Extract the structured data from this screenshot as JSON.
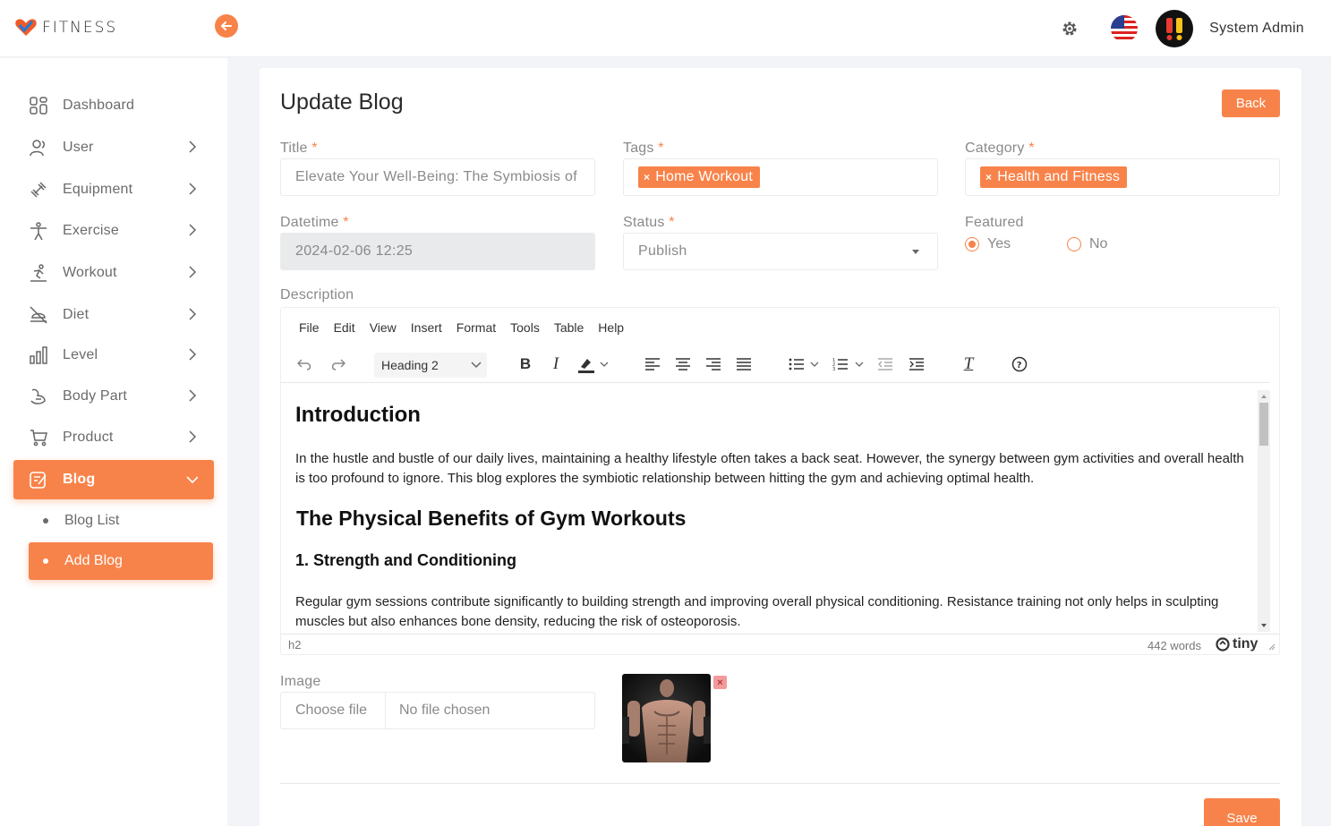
{
  "brand": {
    "logo_text": "FITNESS",
    "accent": "#f8834a"
  },
  "header": {
    "user_name": "System Admin"
  },
  "sidebar": {
    "items": [
      {
        "label": "Dashboard",
        "icon": "dashboard-icon"
      },
      {
        "label": "User",
        "icon": "user-icon"
      },
      {
        "label": "Equipment",
        "icon": "equipment-icon"
      },
      {
        "label": "Exercise",
        "icon": "exercise-icon"
      },
      {
        "label": "Workout",
        "icon": "workout-icon"
      },
      {
        "label": "Diet",
        "icon": "diet-icon"
      },
      {
        "label": "Level",
        "icon": "level-icon"
      },
      {
        "label": "Body Part",
        "icon": "body-part-icon"
      },
      {
        "label": "Product",
        "icon": "cart-icon"
      },
      {
        "label": "Blog",
        "icon": "blog-icon"
      }
    ],
    "blog_sub": [
      {
        "label": "Blog List"
      },
      {
        "label": "Add Blog"
      }
    ]
  },
  "page": {
    "title": "Update Blog",
    "back_label": "Back",
    "save_label": "Save"
  },
  "form": {
    "title_label": "Title",
    "title_value": "Elevate Your Well-Being: The Symbiosis of",
    "tags_label": "Tags",
    "tags": [
      "Home Workout"
    ],
    "category_label": "Category",
    "categories": [
      "Health and Fitness"
    ],
    "datetime_label": "Datetime",
    "datetime_value": "2024-02-06 12:25",
    "status_label": "Status",
    "status_value": "Publish",
    "featured_label": "Featured",
    "featured_yes": "Yes",
    "featured_no": "No",
    "description_label": "Description",
    "image_label": "Image",
    "choose_file": "Choose file",
    "no_file": "No file chosen",
    "required_mark": "*"
  },
  "editor": {
    "menu": [
      "File",
      "Edit",
      "View",
      "Insert",
      "Format",
      "Tools",
      "Table",
      "Help"
    ],
    "block_format": "Heading 2",
    "content": {
      "h_intro": "Introduction",
      "p1": "In the hustle and bustle of our daily lives, maintaining a healthy lifestyle often takes a back seat. However, the synergy between gym activities and overall health is too profound to ignore. This blog explores the symbiotic relationship between hitting the gym and achieving optimal health.",
      "h_physical": "The Physical Benefits of Gym Workouts",
      "h_strength": "1. Strength and Conditioning",
      "p2": "Regular gym sessions contribute significantly to building strength and improving overall physical conditioning. Resistance training not only helps in sculpting muscles but also enhances bone density, reducing the risk of osteoporosis."
    },
    "status_path": "h2",
    "word_count": "442 words",
    "brand": "tiny"
  }
}
